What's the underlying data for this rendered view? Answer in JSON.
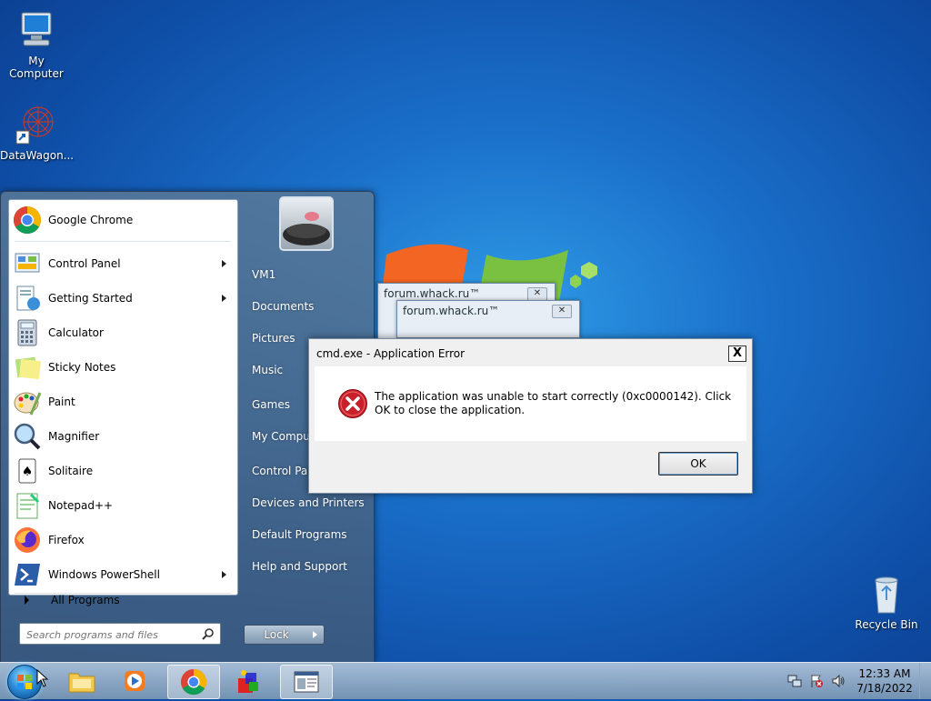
{
  "desktop": {
    "icons": [
      {
        "label": "My Computer"
      },
      {
        "label": "DataWagon..."
      },
      {
        "label": "Recycle Bin"
      }
    ]
  },
  "start_menu": {
    "pinned": [
      {
        "label": "Google Chrome",
        "icon": "chrome-icon",
        "submenu": false
      },
      {
        "label": "Control Panel",
        "icon": "control-panel-icon",
        "submenu": true
      },
      {
        "label": "Getting Started",
        "icon": "getting-started-icon",
        "submenu": true
      },
      {
        "label": "Calculator",
        "icon": "calculator-icon",
        "submenu": false
      },
      {
        "label": "Sticky Notes",
        "icon": "sticky-notes-icon",
        "submenu": false
      },
      {
        "label": "Paint",
        "icon": "paint-icon",
        "submenu": false
      },
      {
        "label": "Magnifier",
        "icon": "magnifier-icon",
        "submenu": false
      },
      {
        "label": "Solitaire",
        "icon": "solitaire-icon",
        "submenu": false
      },
      {
        "label": "Notepad++",
        "icon": "notepadpp-icon",
        "submenu": false
      },
      {
        "label": "Firefox",
        "icon": "firefox-icon",
        "submenu": false
      },
      {
        "label": "Windows PowerShell",
        "icon": "powershell-icon",
        "submenu": true
      }
    ],
    "all_programs": "All Programs",
    "search_placeholder": "Search programs and files",
    "right_items": [
      {
        "label": "VM1"
      },
      {
        "label": "Documents"
      },
      {
        "label": "Pictures"
      },
      {
        "label": "Music"
      },
      {
        "label": "Games"
      },
      {
        "label": "My Computer"
      },
      {
        "label": "Control Panel"
      },
      {
        "label": "Devices and Printers"
      },
      {
        "label": "Default Programs"
      },
      {
        "label": "Help and Support"
      }
    ],
    "lock_label": "Lock"
  },
  "bg_windows": [
    {
      "title": "forum.whack.ru™"
    },
    {
      "title": "forum.whack.ru™"
    }
  ],
  "dialog": {
    "title": "cmd.exe - Application Error",
    "message": "The application was unable to start correctly (0xc0000142). Click OK to close the application.",
    "ok_label": "OK",
    "close_label": "X"
  },
  "taskbar": {
    "apps": [
      "explorer-icon",
      "media-player-icon",
      "chrome-icon",
      "app-icon",
      "window-icon"
    ],
    "time": "12:33 AM",
    "date": "7/18/2022"
  },
  "colors": {
    "desktop": "#1a6fc9",
    "error_red": "#c8202a"
  }
}
